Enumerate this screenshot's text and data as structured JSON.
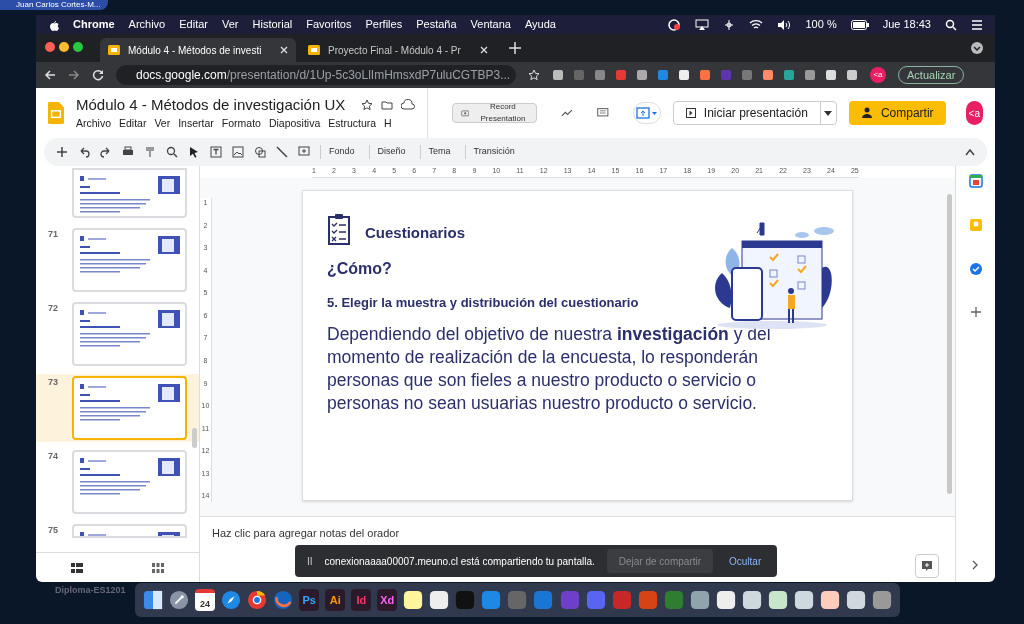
{
  "presenter_chip": "Juan Carlos Cortes-M...",
  "menubar": {
    "app": "Chrome",
    "items": [
      "Archivo",
      "Editar",
      "Ver",
      "Historial",
      "Favoritos",
      "Perfiles",
      "Pestaña",
      "Ventana",
      "Ayuda"
    ],
    "battery": "100 %",
    "clock": "Jue 18:43"
  },
  "tabs": [
    {
      "title": "Módulo 4 - Métodos de investi",
      "selected": true
    },
    {
      "title": "Proyecto Final - Módulo 4 - Pr",
      "selected": false
    }
  ],
  "address": {
    "host": "docs.google.com",
    "path": "/presentation/d/1Up-5c3oLlImHmsxdP7uluCGTBP3..."
  },
  "update_button": "Actualizar",
  "profile_badge": "<a",
  "doc": {
    "title": "Módulo 4 - Métodos de investigación UX",
    "menus": [
      "Archivo",
      "Editar",
      "Ver",
      "Insertar",
      "Formato",
      "Diapositiva",
      "Estructura",
      "H"
    ],
    "record_button": "Record Presentation",
    "present_button": "Iniciar presentación",
    "share_button": "Compartir",
    "avatar": "<a"
  },
  "toolbar": [
    "Fondo",
    "Diseño",
    "Tema",
    "Transición"
  ],
  "ruler_h": [
    "1",
    "2",
    "3",
    "4",
    "5",
    "6",
    "7",
    "8",
    "9",
    "10",
    "11",
    "12",
    "13",
    "14",
    "15",
    "16",
    "17",
    "18",
    "19",
    "20",
    "21",
    "22",
    "23",
    "24",
    "25"
  ],
  "ruler_v": [
    "1",
    "2",
    "3",
    "4",
    "5",
    "6",
    "7",
    "8",
    "9",
    "10",
    "11",
    "12",
    "13",
    "14"
  ],
  "slides": [
    {
      "selected": false
    },
    {
      "number": "71",
      "selected": false
    },
    {
      "number": "72",
      "selected": false
    },
    {
      "number": "73",
      "selected": true
    },
    {
      "number": "74",
      "selected": false
    },
    {
      "number": "75",
      "selected": false
    }
  ],
  "current_slide": {
    "section": "Cuestionarios",
    "question": "¿Cómo?",
    "step": "5. Elegir la muestra y distribución del cuestionario",
    "body": "Dependiendo del objetivo de nuestra **investigación** y del momento de realización de la encuesta, lo responderán personas que son fieles a nuestro producto o servicio o personas no sean usuarias nuestro producto o servicio."
  },
  "notes_placeholder": "Haz clic para agregar notas del orador",
  "share_bar": {
    "pause_glyph": "II",
    "message": "conexionaaaa00007.meuno.cl está compartiendo tu pantalla.",
    "stop": "Dejar de compartir",
    "hide": "Ocultar"
  },
  "desktop_label": "Diploma-ES1201",
  "dock": {
    "calendar_day": "24",
    "apps": [
      "Ps",
      "Ai",
      "Id",
      "Xd"
    ]
  }
}
